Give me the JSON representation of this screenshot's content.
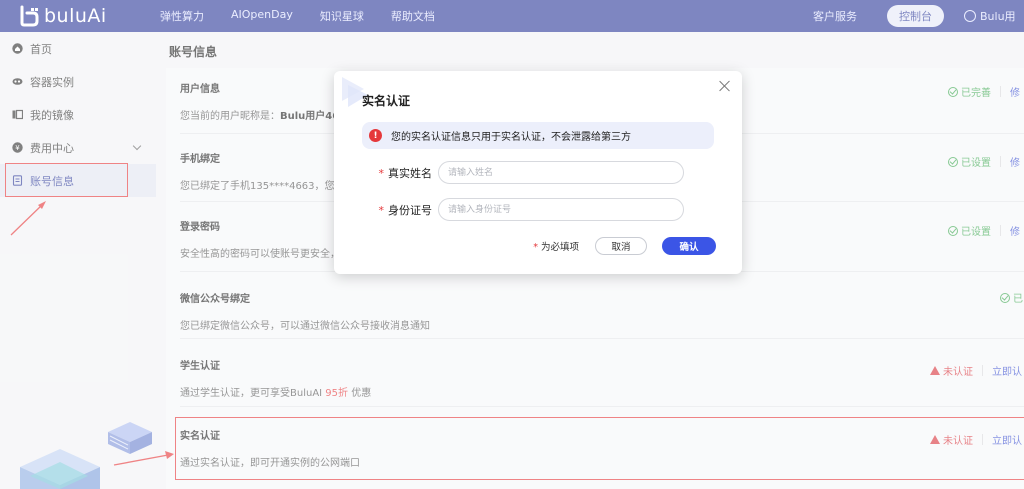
{
  "brand": {
    "name": "buluAi",
    "accent": "#2f3d9c",
    "primary": "#3b55e6",
    "danger": "#e5383b",
    "success": "#3ea851"
  },
  "nav": {
    "items": [
      "弹性算力",
      "AIOpenDay",
      "知识星球",
      "帮助文档"
    ]
  },
  "topbar": {
    "service": "客户服务",
    "console": "控制台",
    "user": "Bulu用"
  },
  "sidebar": {
    "items": [
      {
        "label": "首页",
        "icon": "home-icon"
      },
      {
        "label": "容器实例",
        "icon": "container-icon"
      },
      {
        "label": "我的镜像",
        "icon": "image-icon"
      },
      {
        "label": "费用中心",
        "icon": "billing-icon"
      },
      {
        "label": "账号信息",
        "icon": "account-icon"
      }
    ]
  },
  "page": {
    "title": "账号信息"
  },
  "sections": {
    "user": {
      "title": "用户信息",
      "desc_prefix": "您当前的用户昵称是：",
      "nickname": "Bulu用户46",
      "status": "已完善",
      "action": "修"
    },
    "phone": {
      "title": "手机绑定",
      "desc": "您已绑定了手机135****4663，您",
      "status": "已设置",
      "action": "修"
    },
    "password": {
      "title": "登录密码",
      "desc": "安全性高的密码可以使账号更安全，",
      "status": "已设置",
      "action": "修"
    },
    "wechat": {
      "title": "微信公众号绑定",
      "desc": "您已绑定微信公众号，可以通过微信公众号接收消息通知",
      "status": "已"
    },
    "student": {
      "title": "学生认证",
      "desc_prefix": "通过学生认证，更可享受BuluAI ",
      "discount": "95折",
      "desc_suffix": " 优惠",
      "status": "未认证",
      "action": "立即认"
    },
    "realname": {
      "title": "实名认证",
      "desc": "通过实名认证，即可开通实例的公网端口",
      "status": "未认证",
      "action": "立即认"
    }
  },
  "modal": {
    "title": "实名认证",
    "notice": "您的实名认证信息只用于实名认证，不会泄露给第三方",
    "name_label": "真实姓名",
    "name_placeholder": "请输入姓名",
    "id_label": "身份证号",
    "id_placeholder": "请输入身份证号",
    "required_note": "为必填项",
    "cancel": "取消",
    "confirm": "确认",
    "req_mark": "*"
  }
}
